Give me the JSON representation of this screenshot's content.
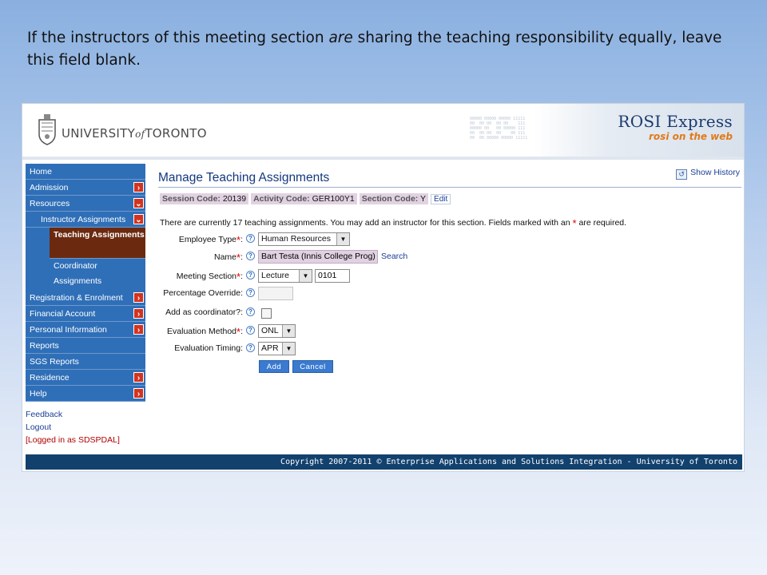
{
  "caption": {
    "before": "If the instructors of this meeting section ",
    "emphasis": "are",
    "after": " sharing the teaching responsibility equally, leave this field blank."
  },
  "header": {
    "university_pre": "UNIVERSITY",
    "university_of": "of",
    "university_post": "TORONTO",
    "app_title": "ROSI Express",
    "app_subtitle": "rosi on the web"
  },
  "sidebar": {
    "items": [
      {
        "label": "Home"
      },
      {
        "label": "Admission"
      },
      {
        "label": "Resources"
      },
      {
        "label": "Instructor Assignments"
      },
      {
        "label": "Teaching Assignments"
      },
      {
        "label": "Coordinator Assignments"
      },
      {
        "label": "Registration & Enrolment"
      },
      {
        "label": "Financial Account"
      },
      {
        "label": "Personal Information"
      },
      {
        "label": "Reports"
      },
      {
        "label": "SGS Reports"
      },
      {
        "label": "Residence"
      },
      {
        "label": "Help"
      }
    ],
    "feedback": "Feedback",
    "logout": "Logout",
    "logged_in": "[Logged in as SDSPDAL]"
  },
  "main": {
    "title": "Manage Teaching Assignments",
    "show_history": "Show History",
    "session_label": "Session Code:",
    "session_value": "20139",
    "activity_label": "Activity Code:",
    "activity_value": "GER100Y1",
    "section_label": "Section Code:",
    "section_value": "Y",
    "edit": "Edit",
    "info_text": "There are currently 17 teaching assignments. You may add an instructor for this section. Fields marked with an",
    "info_star": "*",
    "info_end": "are required.",
    "fields": {
      "employee_type_label": "Employee Type",
      "employee_type_value": "Human Resources",
      "name_label": "Name",
      "name_value": "Bart Testa (Innis College Prog)",
      "search": "Search",
      "meeting_section_label": "Meeting Section",
      "meeting_section_type": "Lecture",
      "meeting_section_code": "0101",
      "percentage_label": "Percentage Override:",
      "coordinator_label": "Add as coordinator?:",
      "eval_method_label": "Evaluation Method",
      "eval_method_value": "ONL",
      "eval_timing_label": "Evaluation Timing:",
      "eval_timing_value": "APR"
    },
    "add_button": "Add",
    "cancel_button": "Cancel"
  },
  "footer": {
    "copyright": "Copyright 2007-2011 © Enterprise Applications and Solutions Integration - University of Toronto"
  },
  "colors": {
    "nav_blue": "#2f6fb8",
    "nav_active": "#6b2a10",
    "footer": "#12416e",
    "highlight": "#e1d2e2"
  }
}
